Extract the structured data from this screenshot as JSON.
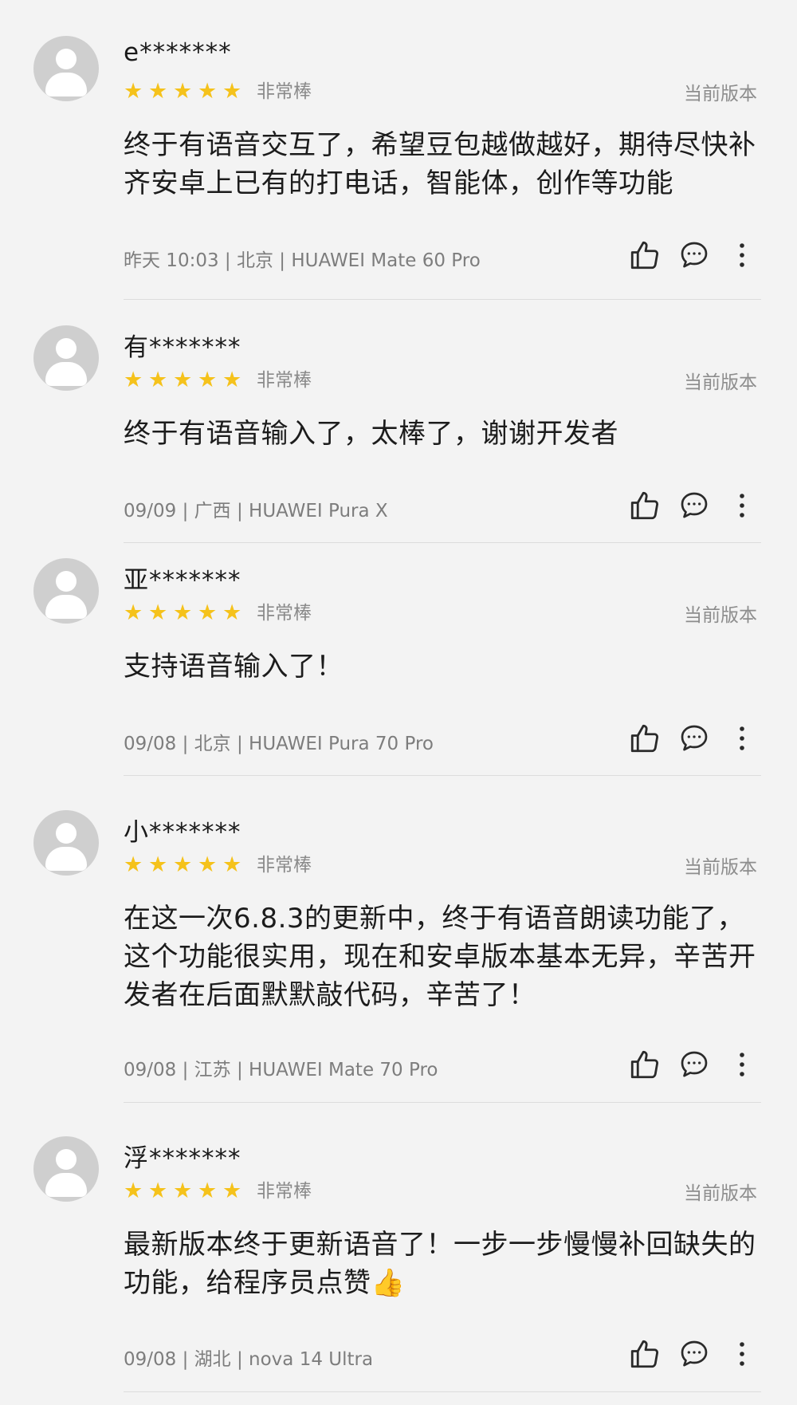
{
  "reviews": [
    {
      "username": "e*******",
      "rating_text": "非常棒",
      "version_tag": "当前版本",
      "content": "终于有语音交互了，希望豆包越做越好，期待尽快补齐安卓上已有的打电话，智能体，创作等功能",
      "meta": "昨天 10:03 | 北京 | HUAWEI Mate 60 Pro",
      "stars": 5
    },
    {
      "username": "有*******",
      "rating_text": "非常棒",
      "version_tag": "当前版本",
      "content": "终于有语音输入了，太棒了，谢谢开发者",
      "meta": "09/09 | 广西 | HUAWEI Pura X",
      "stars": 5
    },
    {
      "username": "亚*******",
      "rating_text": "非常棒",
      "version_tag": "当前版本",
      "content": "支持语音输入了！",
      "meta": "09/08 | 北京 | HUAWEI Pura 70 Pro",
      "stars": 5
    },
    {
      "username": "小*******",
      "rating_text": "非常棒",
      "version_tag": "当前版本",
      "content": "在这一次6.8.3的更新中，终于有语音朗读功能了，这个功能很实用，现在和安卓版本基本无异，辛苦开发者在后面默默敲代码，辛苦了！",
      "meta": "09/08 | 江苏 | HUAWEI Mate 70 Pro",
      "stars": 5
    },
    {
      "username": "浮*******",
      "rating_text": "非常棒",
      "version_tag": "当前版本",
      "content": "最新版本终于更新语音了！一步一步慢慢补回缺失的功能，给程序员点赞👍",
      "meta": "09/08 | 湖北 | nova 14 Ultra",
      "stars": 5
    }
  ],
  "icons": {
    "star": "star-icon",
    "like": "thumbs-up-icon",
    "comment": "comment-icon",
    "more": "more-vertical-icon"
  },
  "colors": {
    "star": "#f5c21b",
    "background": "#f3f3f3"
  }
}
